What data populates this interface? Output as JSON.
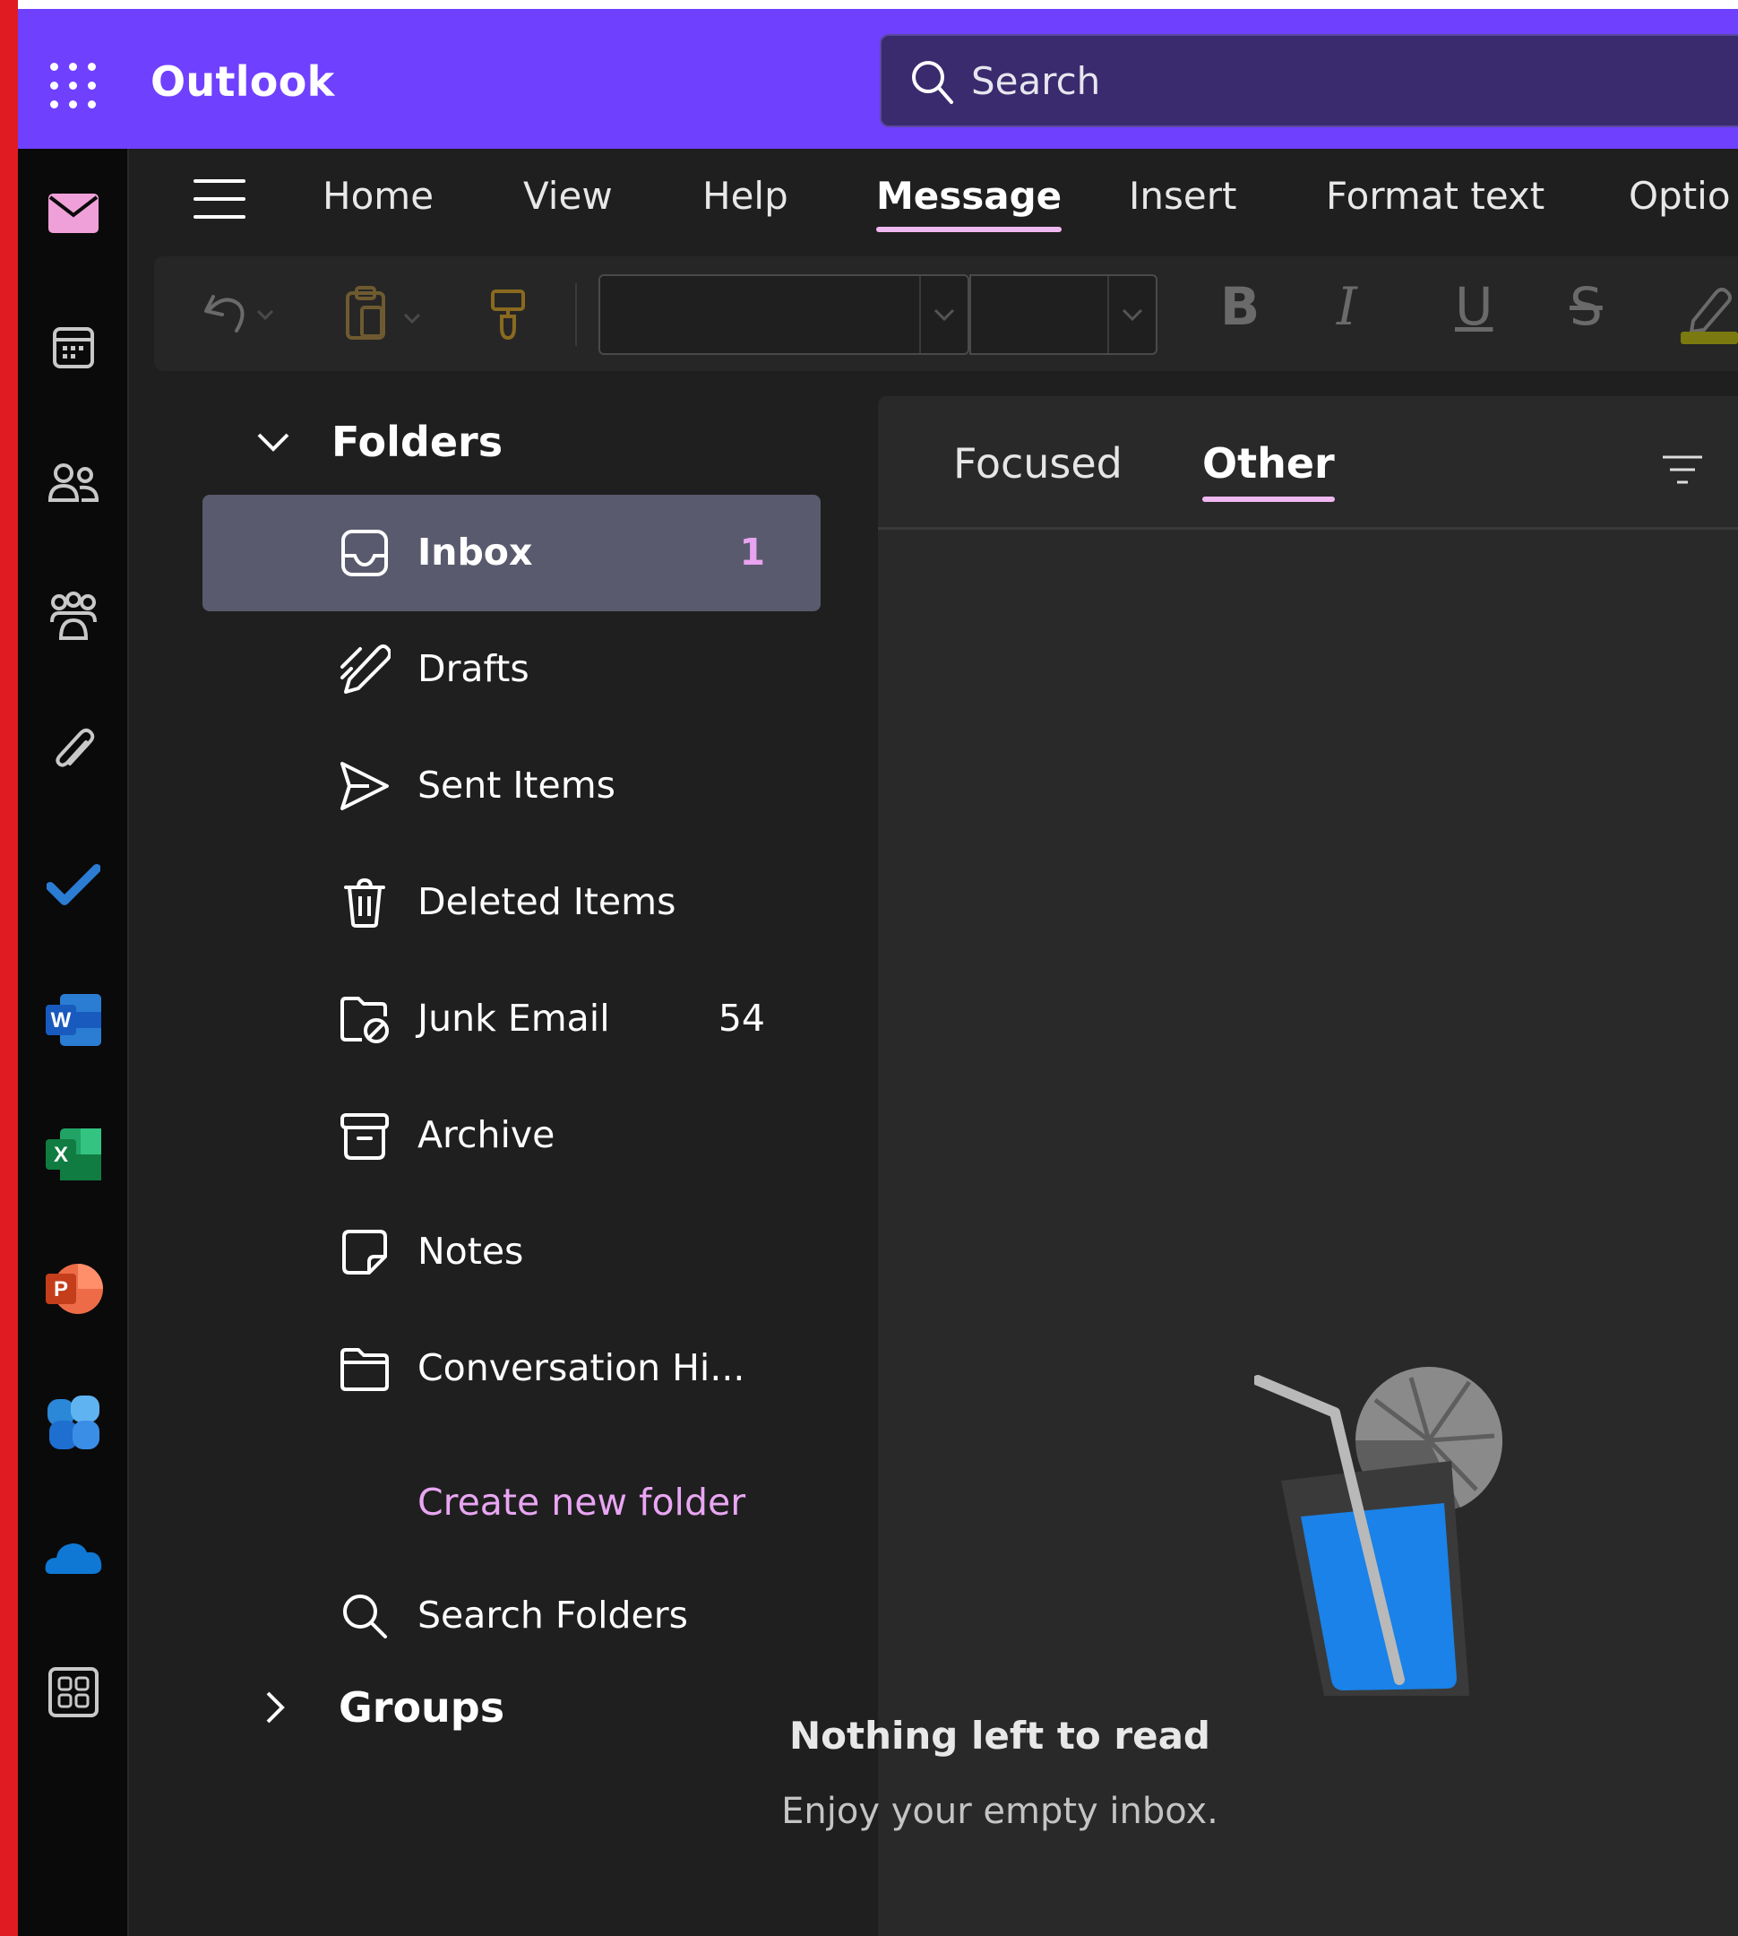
{
  "app": {
    "title": "Outlook"
  },
  "search": {
    "placeholder": "Search"
  },
  "rail": {
    "items": [
      {
        "name": "mail-icon",
        "color": "#f0a0d8"
      },
      {
        "name": "calendar-icon",
        "color": "#c8c8c8"
      },
      {
        "name": "people-icon",
        "color": "#c8c8c8"
      },
      {
        "name": "groups-icon",
        "color": "#c8c8c8"
      },
      {
        "name": "attachment-icon",
        "color": "#c8c8c8"
      },
      {
        "name": "todo-icon",
        "color": "#2b7cd3"
      },
      {
        "name": "word-icon",
        "color": "#185abd"
      },
      {
        "name": "excel-icon",
        "color": "#107c41"
      },
      {
        "name": "powerpoint-icon",
        "color": "#c43e1c"
      },
      {
        "name": "copilot-icon",
        "color": "#3a8ee6"
      },
      {
        "name": "onedrive-icon",
        "color": "#0f78d4"
      },
      {
        "name": "more-apps-icon",
        "color": "#c8c8c8"
      }
    ]
  },
  "ribbon": {
    "tabs": [
      {
        "label": "Home"
      },
      {
        "label": "View"
      },
      {
        "label": "Help"
      },
      {
        "label": "Message",
        "active": true
      },
      {
        "label": "Insert"
      },
      {
        "label": "Format text"
      },
      {
        "label": "Optio"
      }
    ],
    "toolbar": {
      "font_name": "",
      "font_size": "",
      "bold_glyph": "B",
      "italic_glyph": "I",
      "underline_glyph": "U",
      "strike_glyph": "S"
    }
  },
  "folders": {
    "header": "Folders",
    "items": [
      {
        "label": "Inbox",
        "count": "1",
        "icon": "inbox-icon",
        "selected": true
      },
      {
        "label": "Drafts",
        "count": "",
        "icon": "drafts-icon"
      },
      {
        "label": "Sent Items",
        "count": "",
        "icon": "sent-icon"
      },
      {
        "label": "Deleted Items",
        "count": "",
        "icon": "trash-icon"
      },
      {
        "label": "Junk Email",
        "count": "54",
        "icon": "junk-icon"
      },
      {
        "label": "Archive",
        "count": "",
        "icon": "archive-icon"
      },
      {
        "label": "Notes",
        "count": "",
        "icon": "notes-icon"
      },
      {
        "label": "Conversation Hi...",
        "count": "",
        "icon": "folder-icon"
      }
    ],
    "create_new": "Create new folder",
    "search_folders": "Search Folders",
    "groups_header": "Groups"
  },
  "message_list": {
    "tabs": [
      {
        "label": "Focused"
      },
      {
        "label": "Other",
        "active": true
      }
    ],
    "empty_title": "Nothing left to read",
    "empty_subtitle": "Enjoy your empty inbox."
  },
  "colors": {
    "header": "#7040ff",
    "accent": "#f0b8f0",
    "link": "#e9a6f3",
    "selection": "#5a5a6e"
  }
}
